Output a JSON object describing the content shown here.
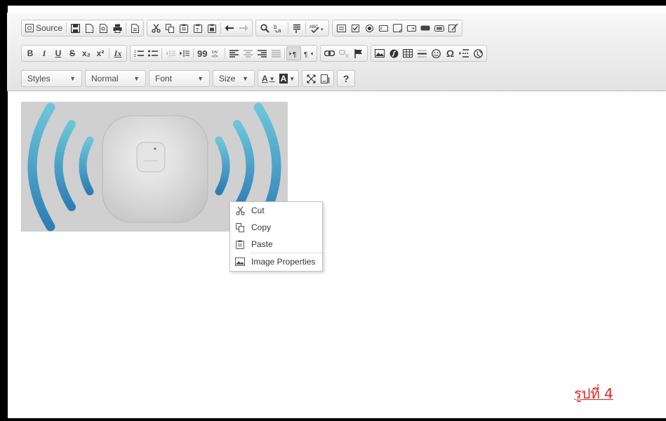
{
  "toolbar": {
    "row1": {
      "source_label": "Source",
      "icons": [
        "save-icon",
        "new-page-icon",
        "preview-icon",
        "print-icon",
        "templates-icon",
        "cut-icon",
        "copy-icon",
        "paste-icon",
        "paste-text-icon",
        "paste-word-icon",
        "undo-icon",
        "redo-icon",
        "find-icon",
        "replace-icon",
        "select-all-icon",
        "spellcheck-icon",
        "form-icon",
        "checkbox-icon",
        "radio-icon",
        "textfield-icon",
        "textarea-icon",
        "select-field-icon",
        "button-icon",
        "image-button-icon",
        "hidden-field-icon"
      ]
    },
    "row2": {
      "bold": "B",
      "italic": "I",
      "underline": "U",
      "strike": "S",
      "subscript": "x₂",
      "superscript": "x²",
      "remove_format": "Ix",
      "blockquote": "99",
      "omega": "Ω"
    },
    "row3": {
      "styles": "Styles",
      "format": "Normal",
      "font": "Font",
      "size": "Size",
      "text_color": "A",
      "bg_color": "A",
      "help": "?"
    }
  },
  "context_menu": {
    "items": [
      {
        "label": "Cut",
        "icon": "cut-icon"
      },
      {
        "label": "Copy",
        "icon": "copy-icon"
      },
      {
        "label": "Paste",
        "icon": "paste-icon"
      },
      {
        "label": "Image Properties",
        "icon": "image-icon"
      }
    ]
  },
  "caption": "รูปที่ 4",
  "colors": {
    "caption": "#e0241c",
    "wave": "#3b8fc4",
    "toolbar_bg": "#ececec"
  }
}
